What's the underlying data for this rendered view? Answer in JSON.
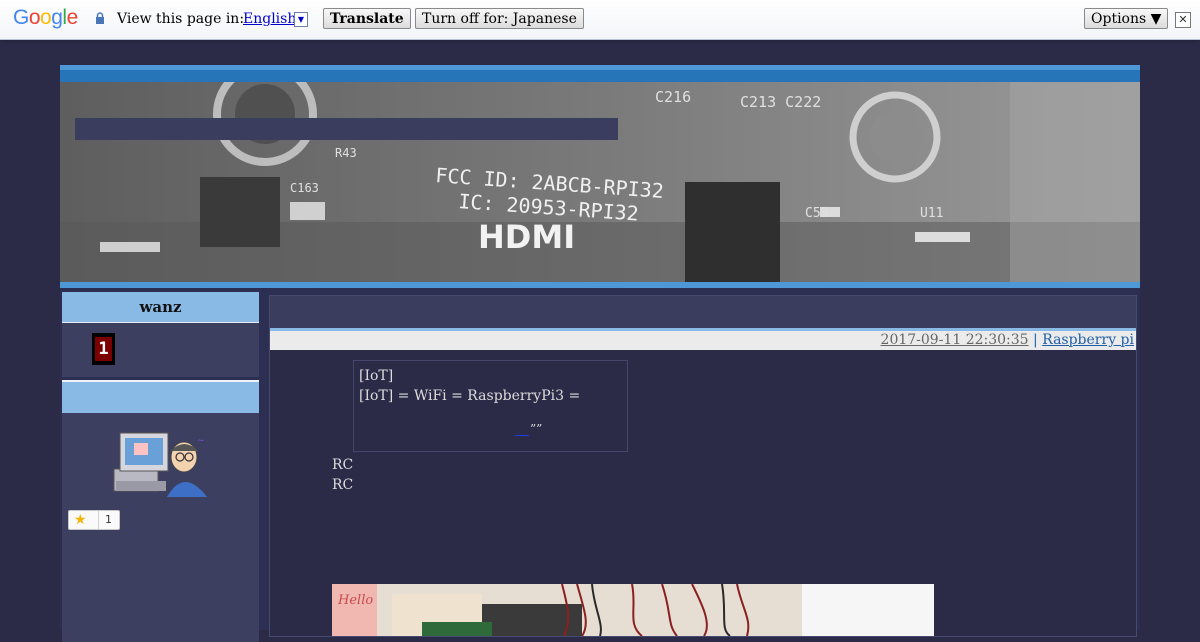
{
  "translate_bar": {
    "logo": "Google",
    "view_label": "View this page in:",
    "language": "English",
    "translate_button": "Translate",
    "turn_off_button": "Turn off for: Japanese",
    "options_button": "Options ▼",
    "close_symbol": "✕"
  },
  "blog": {
    "banner_title": ""
  },
  "sidebar": {
    "profile_name": "wanz",
    "counter_value": "1",
    "star_count": "1"
  },
  "post": {
    "title": "",
    "date": "2017-09-11 22:30:35",
    "separator": "|",
    "category": "Raspberry pi",
    "quote_line1": "[IoT]",
    "quote_line2": "[IoT] = WiFi = RaspberryPi3 =",
    "quote_link": "__",
    "quote_marks": "””",
    "body_line1": "RC",
    "body_line2": "RC"
  },
  "icons": {
    "lock": "lock-icon",
    "star": "star-icon",
    "avatar": "computer-user-icon"
  }
}
